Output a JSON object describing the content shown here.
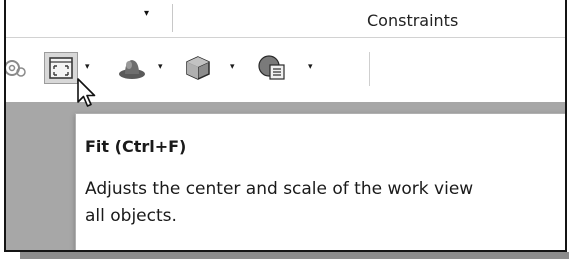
{
  "ribbon": {
    "tab_label": "Constraints"
  },
  "toolbar": {
    "buttons": [
      {
        "name": "settings",
        "icon": "gear-icon"
      },
      {
        "name": "fit",
        "icon": "fit-view-icon",
        "state": "hovered"
      },
      {
        "name": "display-style",
        "icon": "display-style-icon"
      },
      {
        "name": "view-orientation",
        "icon": "cube-icon"
      },
      {
        "name": "hide-show",
        "icon": "hide-show-icon"
      }
    ],
    "dropdown_glyph": "▾"
  },
  "tooltip": {
    "title": "Fit (Ctrl+F)",
    "description_line1": "Adjusts the center and scale of the work view",
    "description_line2": "all objects."
  },
  "colors": {
    "work_area": "#a7a7a7",
    "button_hover": "#d8d8d8"
  }
}
